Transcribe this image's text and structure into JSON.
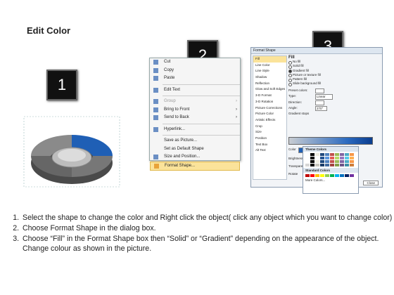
{
  "title": "Edit Color",
  "steps": [
    "1",
    "2",
    "3"
  ],
  "context_menu": {
    "items": [
      {
        "label": "Cut",
        "icon": "scissors-icon",
        "enabled": true
      },
      {
        "label": "Copy",
        "icon": "copy-icon",
        "enabled": true
      },
      {
        "label": "Paste",
        "icon": "paste-icon",
        "enabled": true
      },
      {
        "label": "Edit Text",
        "icon": "edit-text-icon",
        "enabled": true
      },
      {
        "label": "Group",
        "icon": "group-icon",
        "enabled": false
      },
      {
        "label": "Bring to Front",
        "icon": "bring-front-icon",
        "enabled": true
      },
      {
        "label": "Send to Back",
        "icon": "send-back-icon",
        "enabled": true
      },
      {
        "label": "Hyperlink...",
        "icon": "hyperlink-icon",
        "enabled": true
      },
      {
        "label": "Save as Picture...",
        "icon": "",
        "enabled": true
      },
      {
        "label": "Set as Default Shape",
        "icon": "",
        "enabled": true
      },
      {
        "label": "Size and Position...",
        "icon": "size-icon",
        "enabled": true
      },
      {
        "label": "Format Shape...",
        "icon": "format-shape-icon",
        "enabled": true,
        "highlighted": true
      }
    ]
  },
  "dialog": {
    "title": "Format Shape",
    "categories": [
      "Fill",
      "Line Color",
      "Line Style",
      "Shadow",
      "Reflection",
      "Glow and Soft Edges",
      "3-D Format",
      "3-D Rotation",
      "Picture Corrections",
      "Picture Color",
      "Artistic Effects",
      "Crop",
      "Size",
      "Position",
      "Text Box",
      "Alt Text"
    ],
    "fill_title": "Fill",
    "fill_options": [
      "No fill",
      "Solid fill",
      "Gradient fill",
      "Picture or texture fill",
      "Pattern fill",
      "Slide background fill"
    ],
    "selected_fill": "Gradient fill",
    "preset_label": "Preset colors:",
    "type_label": "Type:",
    "type_value": "Linear",
    "direction_label": "Direction:",
    "angle_label": "Angle:",
    "angle_value": "270°",
    "stops_label": "Gradient stops",
    "color_label": "Color",
    "position_label": "Position:",
    "position_value": "0%",
    "brightness_label": "Brightness",
    "transparency_label": "Transparency",
    "rotate_label": "Rotate",
    "close_label": "Close"
  },
  "palette": {
    "theme_title": "Theme Colors",
    "standard_title": "Standard Colors",
    "more_label": "More Colors...",
    "theme_row": [
      "#ffffff",
      "#000000",
      "#eeece1",
      "#1f497d",
      "#4f81bd",
      "#c0504d",
      "#9bbb59",
      "#8064a2",
      "#4bacc6",
      "#f79646"
    ],
    "standard_row": [
      "#c00000",
      "#ff0000",
      "#ffc000",
      "#ffff00",
      "#92d050",
      "#00b050",
      "#00b0f0",
      "#0070c0",
      "#002060",
      "#7030a0"
    ]
  },
  "colors": {
    "accent_blue": "#1f5fb5",
    "ring_gray": "#6e6e6e"
  },
  "instructions": [
    "Select the shape to change the color and Right click the object( click any object which you want to change color)",
    "Choose Format Shape in the dialog box.",
    "Choose “Fill” in the Format Shape box then “Solid” or “Gradient” depending on the appearance of the object. Change colour as shown in the picture."
  ]
}
